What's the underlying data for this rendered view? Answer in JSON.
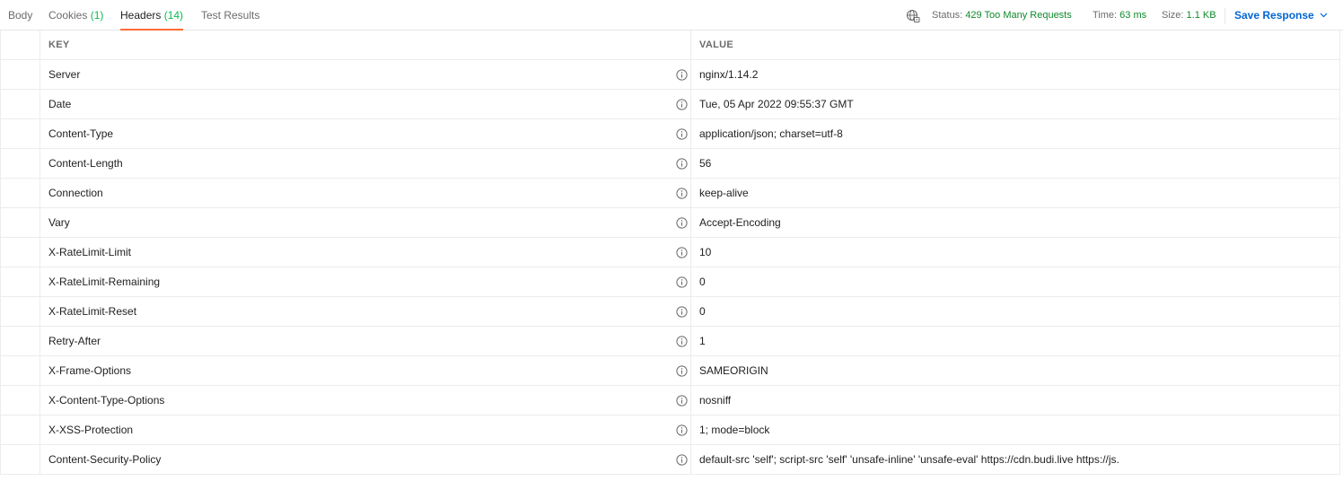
{
  "tabs": [
    {
      "label": "Body",
      "count": ""
    },
    {
      "label": "Cookies",
      "count": "(1)"
    },
    {
      "label": "Headers",
      "count": "(14)"
    },
    {
      "label": "Test Results",
      "count": ""
    }
  ],
  "response_meta": {
    "status_label": "Status:",
    "status_value": "429 Too Many Requests",
    "time_label": "Time:",
    "time_value": "63 ms",
    "size_label": "Size:",
    "size_value": "1.1 KB",
    "save_label": "Save Response"
  },
  "table": {
    "columns": [
      "KEY",
      "VALUE"
    ],
    "rows": [
      {
        "key": "Server",
        "value": "nginx/1.14.2"
      },
      {
        "key": "Date",
        "value": "Tue, 05 Apr 2022 09:55:37 GMT"
      },
      {
        "key": "Content-Type",
        "value": "application/json; charset=utf-8"
      },
      {
        "key": "Content-Length",
        "value": "56"
      },
      {
        "key": "Connection",
        "value": "keep-alive"
      },
      {
        "key": "Vary",
        "value": "Accept-Encoding"
      },
      {
        "key": "X-RateLimit-Limit",
        "value": "10"
      },
      {
        "key": "X-RateLimit-Remaining",
        "value": "0"
      },
      {
        "key": "X-RateLimit-Reset",
        "value": "0"
      },
      {
        "key": "Retry-After",
        "value": "1"
      },
      {
        "key": "X-Frame-Options",
        "value": "SAMEORIGIN"
      },
      {
        "key": "X-Content-Type-Options",
        "value": "nosniff"
      },
      {
        "key": "X-XSS-Protection",
        "value": "1; mode=block"
      },
      {
        "key": "Content-Security-Policy",
        "value": "default-src 'self'; script-src 'self' 'unsafe-inline' 'unsafe-eval' https://cdn.budi.live https://js."
      }
    ]
  },
  "colors": {
    "active_tab_underline": "#ff6c37",
    "status_ok_text": "#0f8a2b",
    "count_text": "#0cbb52",
    "save_link": "#0265d2"
  }
}
